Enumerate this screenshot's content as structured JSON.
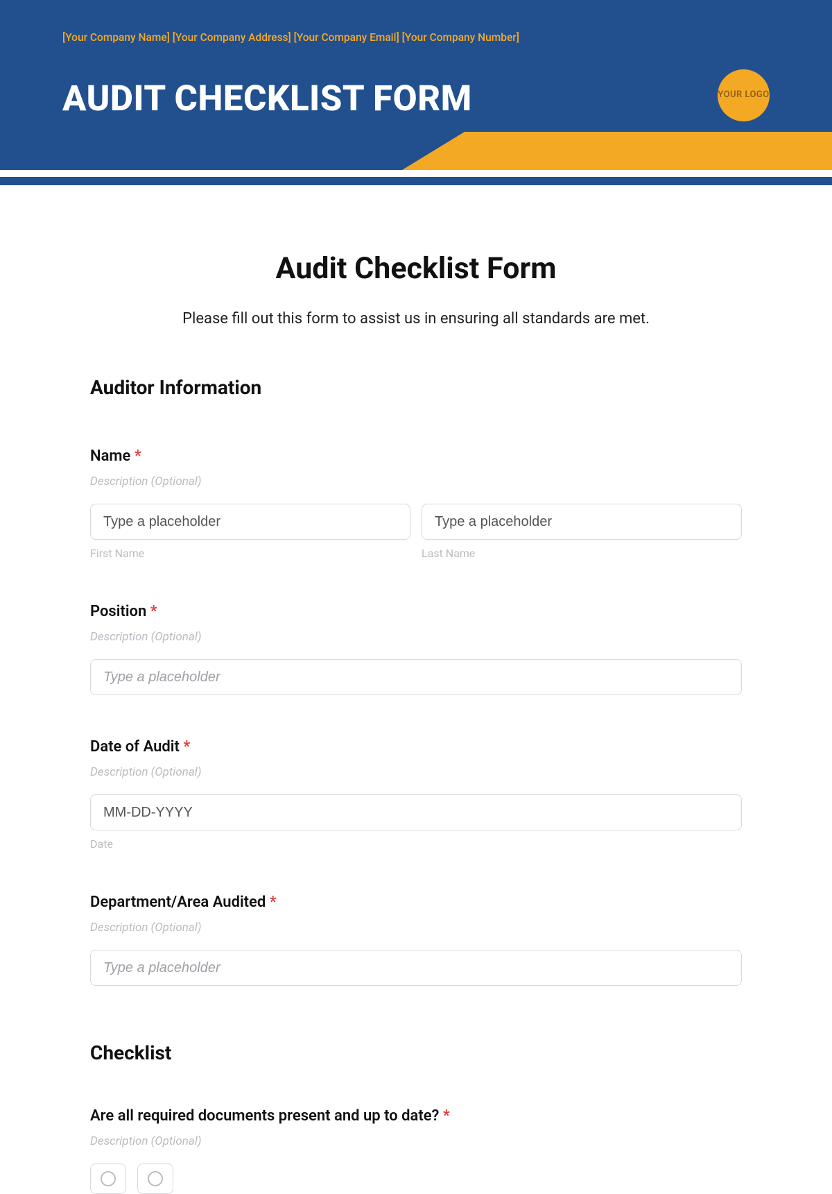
{
  "header": {
    "company_line": "[Your Company Name] [Your Company Address] [Your Company Email] [Your Company Number]",
    "title": "AUDIT CHECKLIST FORM",
    "logo_text": "YOUR LOGO"
  },
  "form": {
    "title": "Audit Checklist Form",
    "subtitle": "Please fill out this form to assist us in ensuring all standards are met."
  },
  "sections": {
    "auditor_info": "Auditor Information",
    "checklist": "Checklist"
  },
  "fields": {
    "name": {
      "label": "Name",
      "required": "*",
      "desc": "Description (Optional)",
      "first_placeholder": "Type a placeholder",
      "last_placeholder": "Type a placeholder",
      "first_sub": "First Name",
      "last_sub": "Last Name"
    },
    "position": {
      "label": "Position",
      "required": "*",
      "desc": "Description (Optional)",
      "placeholder": "Type a placeholder"
    },
    "date": {
      "label": "Date of Audit",
      "required": "*",
      "desc": "Description (Optional)",
      "placeholder": "MM-DD-YYYY",
      "sub": "Date"
    },
    "dept": {
      "label": "Department/Area Audited",
      "required": "*",
      "desc": "Description (Optional)",
      "placeholder": "Type a placeholder"
    },
    "q1": {
      "label": "Are all required documents present and up to date?",
      "required": "*",
      "desc": "Description (Optional)"
    }
  }
}
